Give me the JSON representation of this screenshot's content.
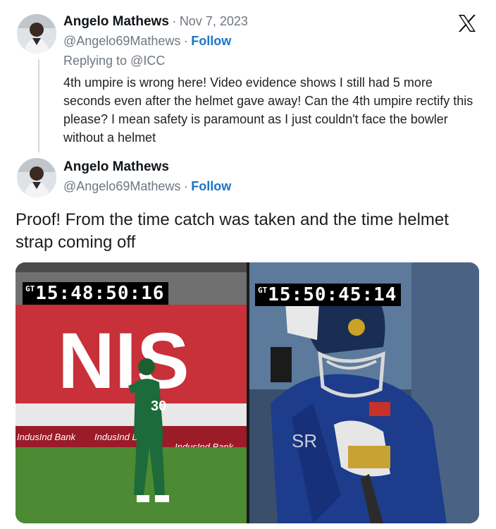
{
  "reply_tweet": {
    "author_name": "Angelo Mathews",
    "separator": "·",
    "date": "Nov 7, 2023",
    "handle": "@Angelo69Mathews",
    "follow_label": "Follow",
    "replying_to": "Replying to @ICC",
    "text": "4th umpire is wrong here! Video evidence shows I still had 5 more seconds even after the helmet gave away! Can the 4th umpire rectify this please? I mean safety is paramount as I just couldn't face the bowler without a helmet"
  },
  "main_tweet": {
    "author_name": "Angelo Mathews",
    "handle": "@Angelo69Mathews",
    "follow_label": "Follow",
    "text": "Proof! From the time catch was taken and the time helmet strap coming off"
  },
  "media": {
    "left_timecode": "15:48:50:16",
    "right_timecode": "15:50:45:14",
    "timecode_prefix": "GT",
    "left_board_text": "NIS",
    "ad_text": "IndusInd Bank",
    "shirt_number": "30",
    "jersey_text": "SR"
  },
  "icons": {
    "logo": "x-logo-icon",
    "avatar": "profile-avatar"
  }
}
